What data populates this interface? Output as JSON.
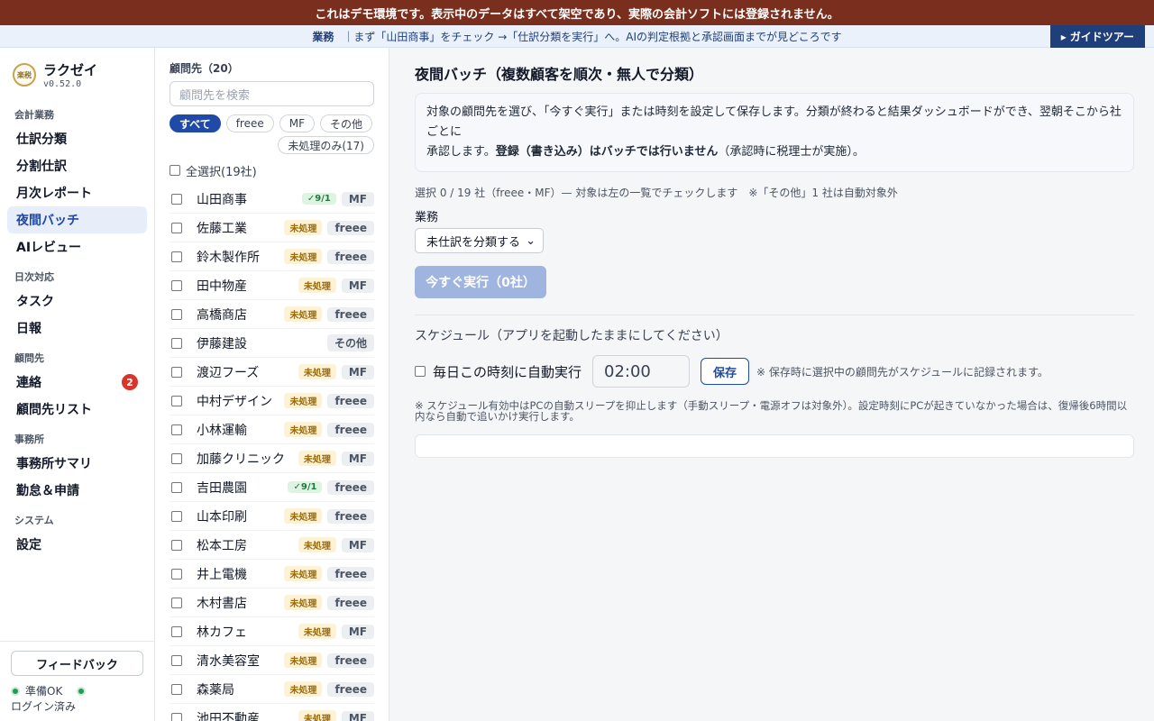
{
  "banner": {
    "text": "これはデモ環境です。表示中のデータはすべて架空であり、実際の会計ソフトには登録されません。"
  },
  "guide": {
    "label": "業務",
    "text": "｜まず「山田商事」をチェック →「仕訳分類を実行」へ。AIの判定根拠と承認画面までが見どころです",
    "tour_button": "ガイドツアー"
  },
  "brand": {
    "name": "ラクゼイ",
    "version": "v0.52.0",
    "logo_text": "楽税"
  },
  "sidebar": {
    "sections": [
      {
        "title": "会計業務",
        "items": [
          {
            "label": "仕訳分類"
          },
          {
            "label": "分割仕訳"
          },
          {
            "label": "月次レポート"
          },
          {
            "label": "夜間バッチ",
            "active": true
          },
          {
            "label": "AIレビュー"
          }
        ]
      },
      {
        "title": "日次対応",
        "items": [
          {
            "label": "タスク"
          },
          {
            "label": "日報"
          }
        ]
      },
      {
        "title": "顧問先",
        "items": [
          {
            "label": "連絡",
            "badge": "2"
          },
          {
            "label": "顧問先リスト"
          }
        ]
      },
      {
        "title": "事務所",
        "items": [
          {
            "label": "事務所サマリ"
          },
          {
            "label": "勤怠＆申請"
          }
        ]
      },
      {
        "title": "システム",
        "items": [
          {
            "label": "設定"
          }
        ]
      }
    ],
    "feedback_button": "フィードバック",
    "status": "準備OK",
    "login": "ログイン済み"
  },
  "clients": {
    "count_label": "顧問先（20）",
    "search_placeholder": "顧問先を検索",
    "filters": [
      "すべて",
      "freee",
      "MF",
      "その他"
    ],
    "unprocessed_filter": "未処理のみ(17)",
    "select_all": "全選択(19社)",
    "list": [
      {
        "name": "山田商事",
        "status": "✓9/1",
        "status_type": "done",
        "system": "MF"
      },
      {
        "name": "佐藤工業",
        "status": "未処理",
        "status_type": "pending",
        "system": "freee"
      },
      {
        "name": "鈴木製作所",
        "status": "未処理",
        "status_type": "pending",
        "system": "freee"
      },
      {
        "name": "田中物産",
        "status": "未処理",
        "status_type": "pending",
        "system": "MF"
      },
      {
        "name": "高橋商店",
        "status": "未処理",
        "status_type": "pending",
        "system": "freee"
      },
      {
        "name": "伊藤建設",
        "status": "",
        "status_type": "none",
        "system": "その他"
      },
      {
        "name": "渡辺フーズ",
        "status": "未処理",
        "status_type": "pending",
        "system": "MF"
      },
      {
        "name": "中村デザイン",
        "status": "未処理",
        "status_type": "pending",
        "system": "freee"
      },
      {
        "name": "小林運輸",
        "status": "未処理",
        "status_type": "pending",
        "system": "freee"
      },
      {
        "name": "加藤クリニック",
        "status": "未処理",
        "status_type": "pending",
        "system": "MF"
      },
      {
        "name": "吉田農園",
        "status": "✓9/1",
        "status_type": "done",
        "system": "freee"
      },
      {
        "name": "山本印刷",
        "status": "未処理",
        "status_type": "pending",
        "system": "freee"
      },
      {
        "name": "松本工房",
        "status": "未処理",
        "status_type": "pending",
        "system": "MF"
      },
      {
        "name": "井上電機",
        "status": "未処理",
        "status_type": "pending",
        "system": "freee"
      },
      {
        "name": "木村書店",
        "status": "未処理",
        "status_type": "pending",
        "system": "freee"
      },
      {
        "name": "林カフェ",
        "status": "未処理",
        "status_type": "pending",
        "system": "MF"
      },
      {
        "name": "清水美容室",
        "status": "未処理",
        "status_type": "pending",
        "system": "freee"
      },
      {
        "name": "森薬局",
        "status": "未処理",
        "status_type": "pending",
        "system": "freee"
      },
      {
        "name": "池田不動産",
        "status": "未処理",
        "status_type": "pending",
        "system": "MF"
      }
    ]
  },
  "main": {
    "title": "夜間バッチ（複数顧客を順次・無人で分類）",
    "info_line1": "対象の顧問先を選び、「今すぐ実行」または時刻を設定して保存します。分類が終わると結果ダッシュボードができ、翌朝そこから社ごとに",
    "info_line2_a": "承認します。",
    "info_line2_bold": "登録（書き込み）はバッチでは行いません",
    "info_line2_b": "（承認時に税理士が実施）。",
    "selection": "選択 0 / 19 社（freee・MF）— 対象は左の一覧でチェックします　※「その他」1 社は自動対象外",
    "task_label": "業務",
    "task_value": "未仕訳を分類する",
    "run_button": "今すぐ実行（0社）",
    "schedule_title": "スケジュール（アプリを起動したままにしてください）",
    "schedule_checkbox": "毎日この時刻に自動実行",
    "schedule_time": "02:00",
    "save_button": "保存",
    "save_note": "※ 保存時に選択中の顧問先がスケジュールに記録されます。",
    "schedule_note": "※ スケジュール有効中はPCの自動スリープを抑止します（手動スリープ・電源オフは対象外）。設定時刻にPCが起きていなかった場合は、復帰後6時間以内なら自動で追いかけ実行します。"
  }
}
